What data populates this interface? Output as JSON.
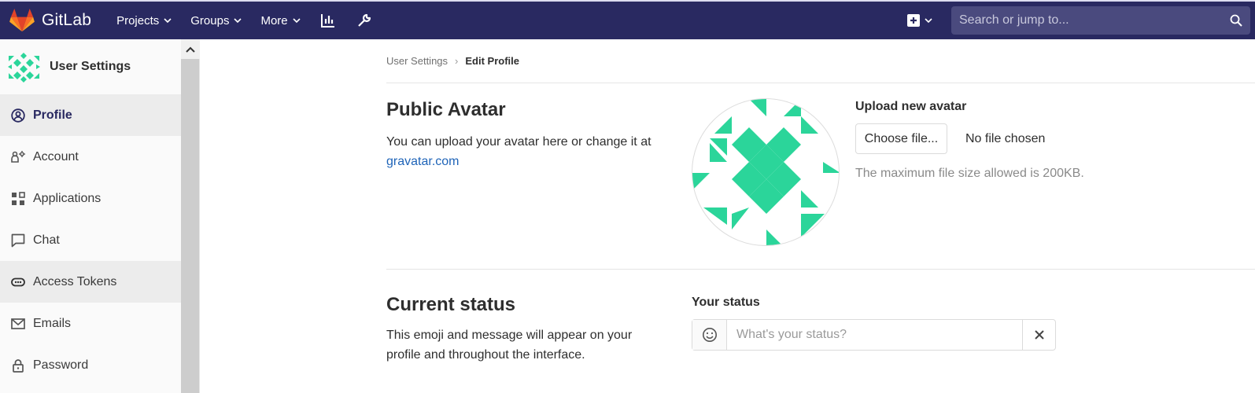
{
  "navbar": {
    "brand": "GitLab",
    "menu": [
      {
        "label": "Projects",
        "icon": "chevron-down-icon"
      },
      {
        "label": "Groups",
        "icon": "chevron-down-icon"
      },
      {
        "label": "More",
        "icon": "chevron-down-icon"
      }
    ],
    "icons": [
      "activity-chart-icon",
      "admin-wrench-icon",
      "plus-square-icon",
      "search-icon"
    ],
    "search_placeholder": "Search or jump to...",
    "bg_color": "#292961"
  },
  "sidebar": {
    "title": "User Settings",
    "items": [
      {
        "label": "Profile",
        "icon": "profile-icon",
        "active": true
      },
      {
        "label": "Account",
        "icon": "account-icon"
      },
      {
        "label": "Applications",
        "icon": "applications-icon"
      },
      {
        "label": "Chat",
        "icon": "chat-icon"
      },
      {
        "label": "Access Tokens",
        "icon": "token-icon"
      },
      {
        "label": "Emails",
        "icon": "email-icon"
      },
      {
        "label": "Password",
        "icon": "lock-icon"
      }
    ]
  },
  "breadcrumb": {
    "parent": "User Settings",
    "current": "Edit Profile"
  },
  "avatar_section": {
    "title": "Public Avatar",
    "description": "You can upload your avatar here or change it at",
    "link": "gravatar.com",
    "upload_label": "Upload new avatar",
    "choose_button": "Choose file...",
    "no_file": "No file chosen",
    "help": "The maximum file size allowed is 200KB.",
    "avatar_color": "#2bd59a"
  },
  "status_section": {
    "title": "Current status",
    "description": "This emoji and message will appear on your profile and throughout the interface.",
    "label": "Your status",
    "placeholder": "What's your status?"
  }
}
